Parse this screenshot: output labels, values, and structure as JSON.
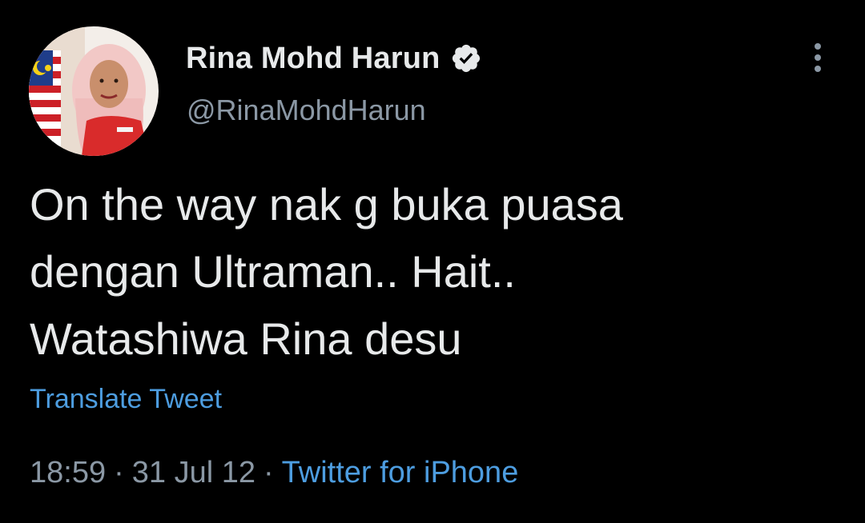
{
  "author": {
    "display_name": "Rina Mohd Harun",
    "handle": "@RinaMohdHarun",
    "verified": true,
    "avatar_icon": "profile-photo"
  },
  "tweet": {
    "text_lines": [
      "On the way nak g buka puasa",
      "dengan Ultraman.. Hait..",
      "Watashiwa Rina desu"
    ],
    "translate_label": "Translate Tweet",
    "time": "18:59",
    "date": "31 Jul 12",
    "separator": "·",
    "source": "Twitter for iPhone"
  },
  "icons": {
    "verified": "verified-badge-icon",
    "more": "more-options-icon"
  },
  "colors": {
    "background": "#000000",
    "primary_text": "#e7e9ea",
    "secondary_text": "#8b98a5",
    "link": "#4d9de0"
  }
}
